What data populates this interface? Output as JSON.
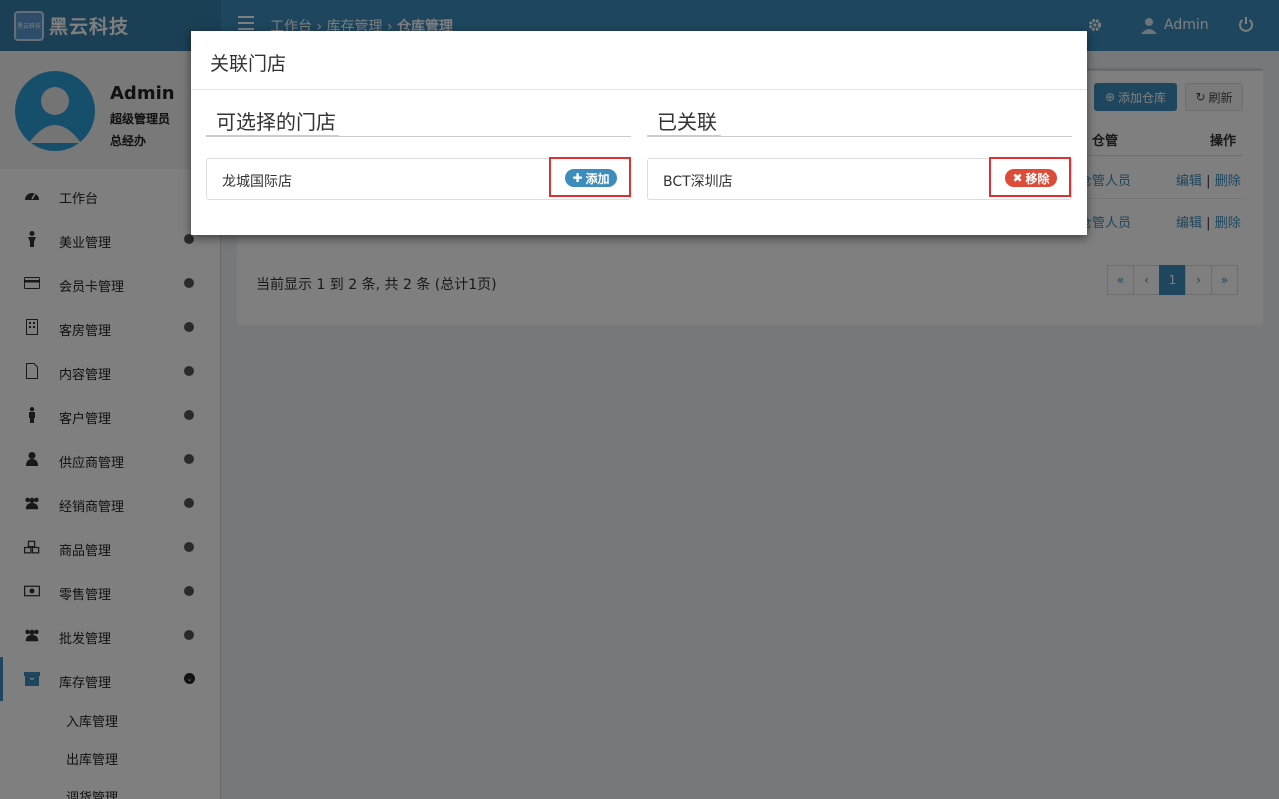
{
  "app": {
    "logo_badge": "黑云科技",
    "logo_text": "黑云科技"
  },
  "topbar": {
    "breadcrumb": [
      "工作台",
      "库存管理",
      "仓库管理"
    ],
    "separator": " › ",
    "user_name": "Admin"
  },
  "user_panel": {
    "name": "Admin",
    "role": "超级管理员",
    "dept": "总经办"
  },
  "sidebar": {
    "items": [
      {
        "label": "工作台",
        "icon": "dashboard-icon"
      },
      {
        "label": "美业管理",
        "icon": "person-icon"
      },
      {
        "label": "会员卡管理",
        "icon": "credit-card-icon"
      },
      {
        "label": "客房管理",
        "icon": "building-icon"
      },
      {
        "label": "内容管理",
        "icon": "file-icon"
      },
      {
        "label": "客户管理",
        "icon": "male-icon"
      },
      {
        "label": "供应商管理",
        "icon": "user-icon"
      },
      {
        "label": "经销商管理",
        "icon": "users-icon"
      },
      {
        "label": "商品管理",
        "icon": "cubes-icon"
      },
      {
        "label": "零售管理",
        "icon": "money-icon"
      },
      {
        "label": "批发管理",
        "icon": "group-icon"
      },
      {
        "label": "库存管理",
        "icon": "archive-icon"
      }
    ],
    "submenu": [
      "入库管理",
      "出库管理",
      "调货管理"
    ]
  },
  "toolbar": {
    "add_label": "添加仓库",
    "refresh_label": "刷新"
  },
  "table": {
    "headers": {
      "manager": "仓管",
      "actions": "操作"
    },
    "rows": [
      {
        "manager": "仓管人员",
        "edit": "编辑",
        "delete": "删除"
      },
      {
        "manager": "仓管人员",
        "edit": "编辑",
        "delete": "删除"
      }
    ],
    "action_separator": "|"
  },
  "footer": {
    "info": "当前显示 1 到 2 条, 共 2 条 (总计1页)"
  },
  "pagination": {
    "first": "«",
    "prev": "‹",
    "current": "1",
    "next": "›",
    "last": "»"
  },
  "modal": {
    "title": "关联门店",
    "left": {
      "title": "可选择的门店",
      "store": "龙城国际店",
      "button": "添加"
    },
    "right": {
      "title": "已关联",
      "store": "BCT深圳店",
      "button": "移除"
    }
  }
}
